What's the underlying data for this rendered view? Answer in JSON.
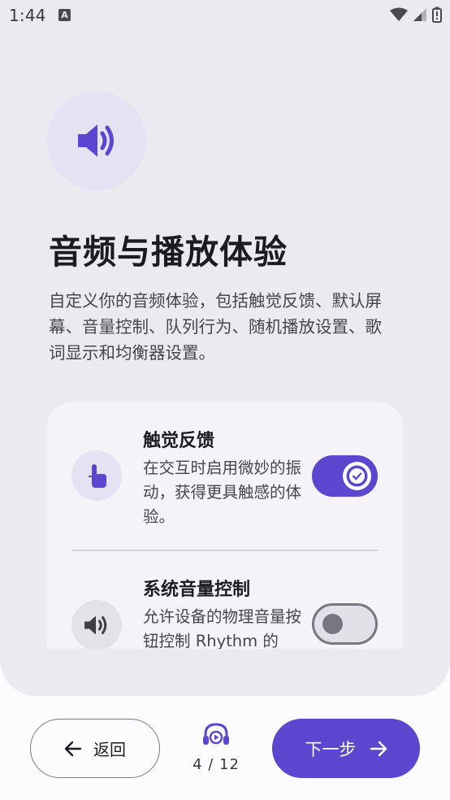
{
  "status_bar": {
    "time": "1:44",
    "notification_icon": "A"
  },
  "hero": {
    "icon": "volume-icon",
    "title": "音频与播放体验",
    "description": "自定义你的音频体验，包括触觉反馈、默认屏幕、音量控制、队列行为、随机播放设置、歌词显示和均衡器设置。"
  },
  "settings": [
    {
      "title": "触觉反馈",
      "subtitle": "在交互时启用微妙的振动，获得更具触感的体验。",
      "icon": "touch-icon",
      "enabled": true
    },
    {
      "title": "系统音量控制",
      "subtitle": "允许设备的物理音量按钮控制 Rhythm 的",
      "icon": "volume-icon",
      "enabled": false
    }
  ],
  "nav": {
    "back_label": "返回",
    "progress": "4 / 12",
    "next_label": "下一步"
  },
  "colors": {
    "accent": "#5b47cf",
    "card_bg": "#eceaf0",
    "panel_bg": "#f5f3f8"
  }
}
